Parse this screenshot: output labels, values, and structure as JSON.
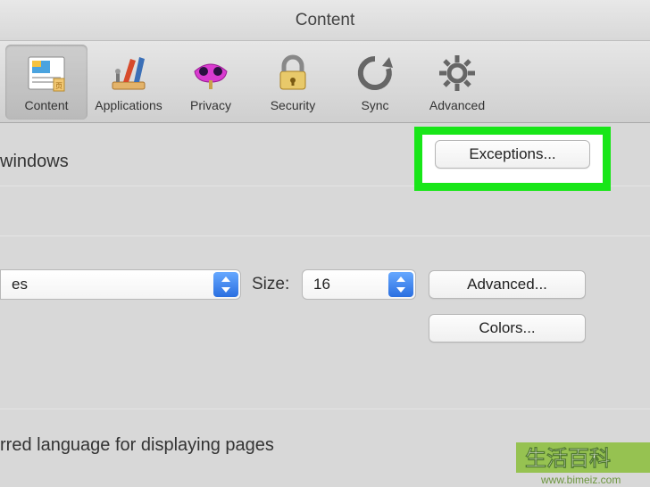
{
  "window": {
    "title": "Content"
  },
  "toolbar": {
    "items": [
      {
        "label": "Content",
        "active": true
      },
      {
        "label": "Applications",
        "active": false
      },
      {
        "label": "Privacy",
        "active": false
      },
      {
        "label": "Security",
        "active": false
      },
      {
        "label": "Sync",
        "active": false
      },
      {
        "label": "Advanced",
        "active": false
      }
    ]
  },
  "content": {
    "popup_fragment": "windows",
    "exceptions_button": "Exceptions...",
    "font_fragment": "es",
    "size_label": "Size:",
    "size_value": "16",
    "advanced_button": "Advanced...",
    "colors_button": "Colors...",
    "language_label_fragment": "rred language for displaying pages"
  },
  "watermark": {
    "text_main": "生活百科",
    "text_url": "www.bimeiz.com"
  }
}
